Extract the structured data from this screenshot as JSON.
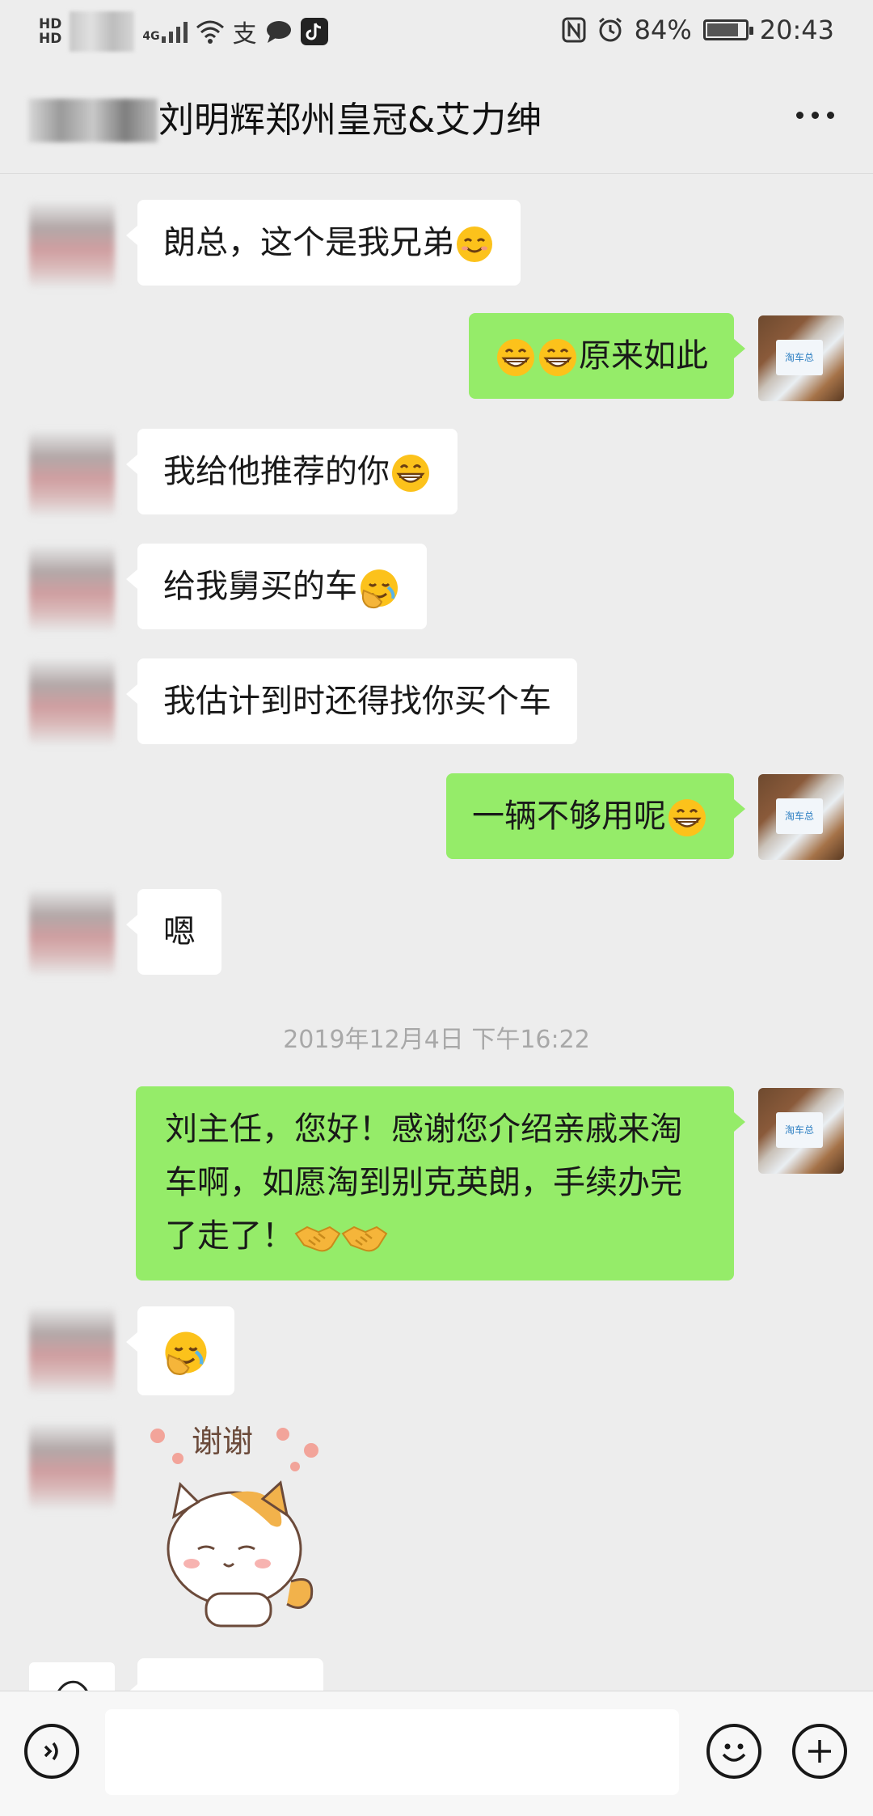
{
  "status_bar": {
    "hd_label": "HD",
    "network": "4G",
    "battery_percent": "84%",
    "battery_level": 0.84,
    "time": "20:43"
  },
  "header": {
    "title": "刘明辉郑州皇冠&艾力绅",
    "more_icon": "more-dots-icon"
  },
  "messages": [
    {
      "side": "left",
      "text": "朗总，这个是我兄弟",
      "emoji": "smiling-face-icon"
    },
    {
      "side": "right",
      "text": "原来如此",
      "emoji_before": [
        "grinning-face-icon",
        "grinning-face-icon"
      ]
    },
    {
      "side": "left",
      "text": "我给他推荐的你",
      "emoji": "grinning-face-icon"
    },
    {
      "side": "left",
      "text": "给我舅买的车",
      "emoji": "face-palm-icon"
    },
    {
      "side": "left",
      "text": "我估计到时还得找你买个车"
    },
    {
      "side": "right",
      "text": "一辆不够用呢",
      "emoji": "grinning-face-icon"
    },
    {
      "side": "left",
      "text": "嗯"
    },
    {
      "side": "right",
      "text": "刘主任，您好！感谢您介绍亲戚来淘车啊，如愿淘到别克英朗，手续办完了走了！",
      "emoji": [
        "handshake-icon",
        "handshake-icon"
      ]
    },
    {
      "side": "left",
      "emoji_only": "face-palm-icon"
    },
    {
      "side": "left",
      "sticker": "thank-you-cat-sticker",
      "sticker_text": "谢谢"
    }
  ],
  "timestamp": "2019年12月4日 下午16:22",
  "input_bar": {
    "voice_icon": "voice-icon",
    "emoji_icon": "emoji-icon",
    "plus_icon": "plus-icon",
    "value": ""
  },
  "colors": {
    "background": "#ededed",
    "my_bubble": "#95ec69",
    "their_bubble": "#ffffff",
    "timestamp": "#a8a8a8"
  }
}
